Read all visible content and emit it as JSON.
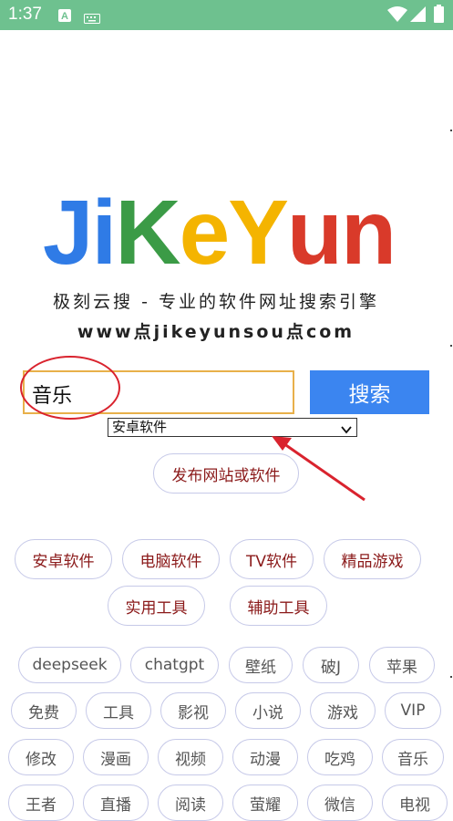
{
  "status_bar": {
    "time": "1:37",
    "background": "#6ec18f",
    "icons": [
      "text-format-icon",
      "keyboard-icon",
      "wifi-icon",
      "signal-icon",
      "battery-icon"
    ]
  },
  "logo": {
    "letters": [
      {
        "char": "J",
        "color": "#2f7be6"
      },
      {
        "char": "i",
        "color": "#2f7be6"
      },
      {
        "char": "K",
        "color": "#3b9b46"
      },
      {
        "char": "e",
        "color": "#f4b400"
      },
      {
        "char": "Y",
        "color": "#f4b400"
      },
      {
        "char": "u",
        "color": "#d93a2a"
      },
      {
        "char": "n",
        "color": "#d93a2a"
      }
    ]
  },
  "tagline": "极刻云搜 - 专业的软件网址搜索引擎",
  "domain_text": "www点jikeyunsou点com",
  "search": {
    "value": "音乐",
    "button_label": "搜索",
    "button_color": "#3b85f0"
  },
  "category_select": {
    "selected": "安卓软件"
  },
  "publish_label": "发布网站或软件",
  "categories": [
    "安卓软件",
    "电脑软件",
    "TV软件",
    "精品游戏",
    "实用工具",
    "辅助工具"
  ],
  "tags": [
    "deepseek",
    "chatgpt",
    "壁纸",
    "破J",
    "苹果",
    "免费",
    "工具",
    "影视",
    "小说",
    "游戏",
    "VIP",
    "修改",
    "漫画",
    "视频",
    "动漫",
    "吃鸡",
    "音乐",
    "王者",
    "直播",
    "阅读",
    "萤耀",
    "微信",
    "电视"
  ],
  "annotation_color": "#d9232e"
}
